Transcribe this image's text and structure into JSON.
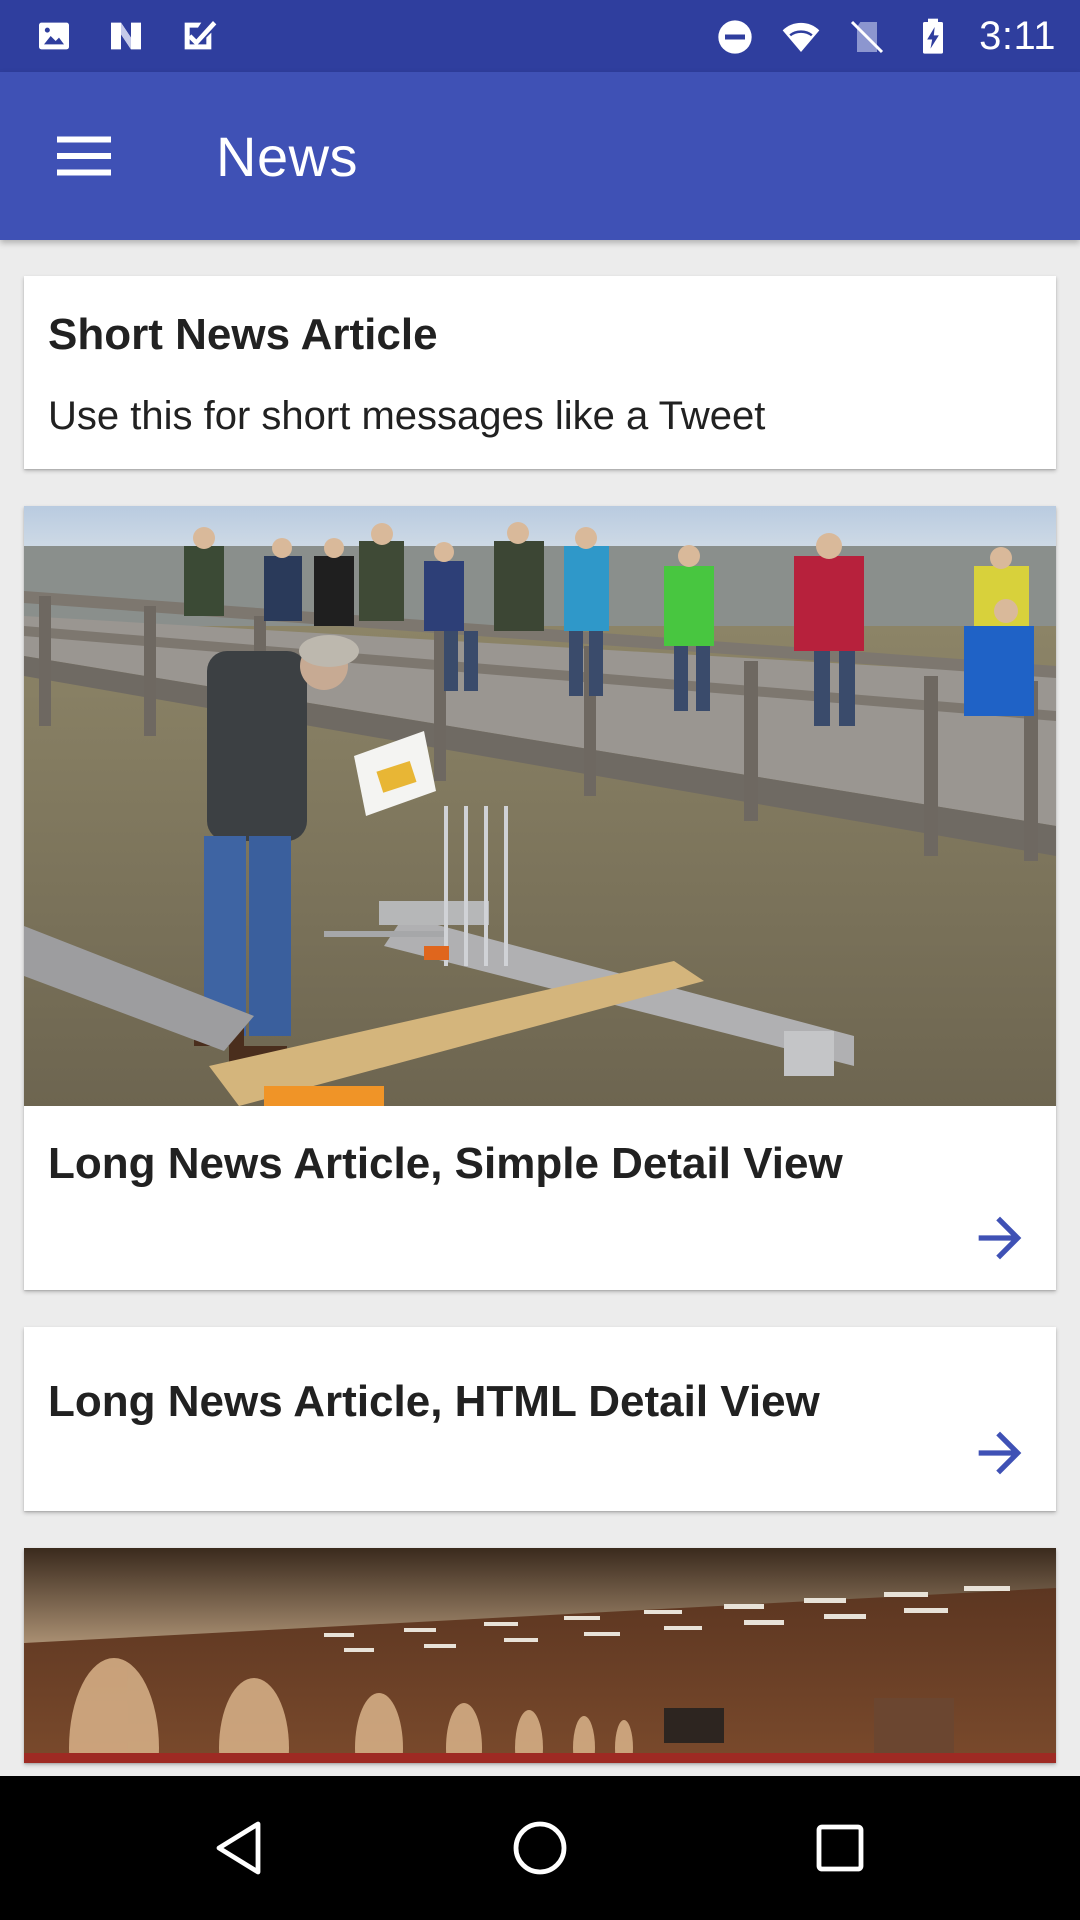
{
  "status_bar": {
    "time": "3:11",
    "left_icons": [
      "image-icon",
      "n-logo-icon",
      "checkbox-icon"
    ],
    "right_icons": [
      "do-not-disturb-icon",
      "wifi-icon",
      "no-sim-icon",
      "battery-charging-icon"
    ]
  },
  "app_bar": {
    "title": "News",
    "menu_icon": "hamburger-menu-icon"
  },
  "cards": [
    {
      "title": "Short News Article",
      "text": "Use this for short messages like a Tweet"
    },
    {
      "title": "Long News Article, Simple Detail View",
      "image": "boardwalk-marsh-photo",
      "action_icon": "arrow-forward-icon"
    },
    {
      "title": "Long News Article, HTML Detail View",
      "action_icon": "arrow-forward-icon"
    },
    {
      "image": "auditorium-photo"
    }
  ],
  "nav_bar": {
    "icons": [
      "back-icon",
      "home-icon",
      "recents-icon"
    ]
  },
  "colors": {
    "status_bar": "#2f3e9e",
    "app_bar": "#3f51b5",
    "accent": "#3f51b5",
    "background": "#ececec",
    "card": "#ffffff",
    "nav_bar": "#000000"
  }
}
